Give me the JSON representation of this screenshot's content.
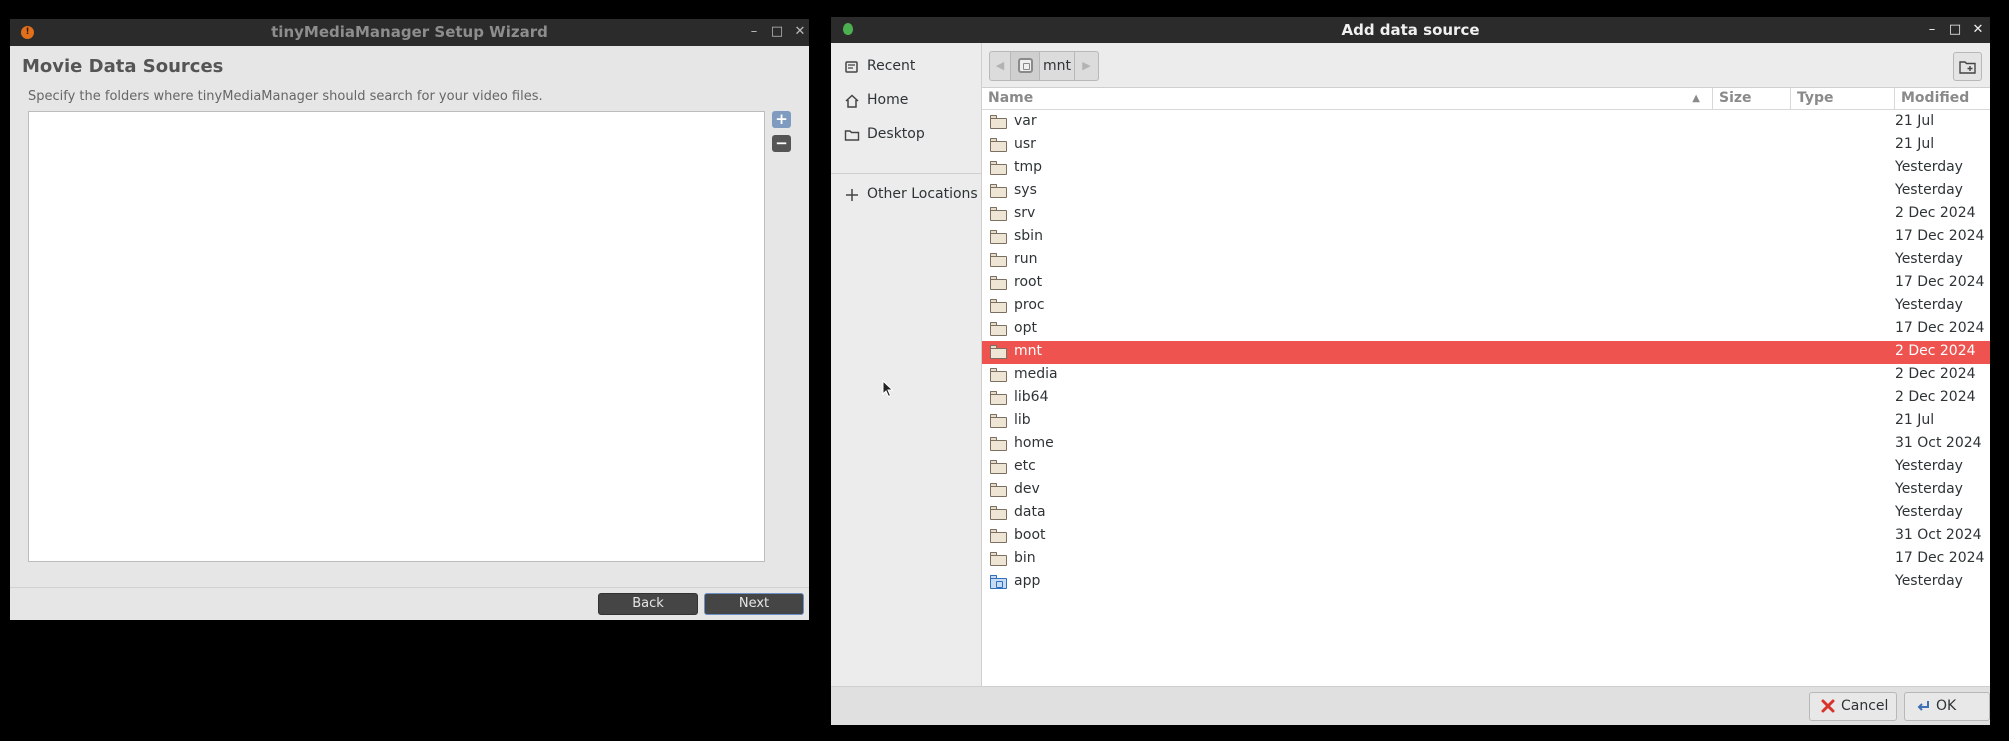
{
  "wizard": {
    "title": "tinyMediaManager Setup Wizard",
    "heading": "Movie Data Sources",
    "description": "Specify the folders where tinyMediaManager should search for your video files.",
    "add_label": "+",
    "remove_label": "−",
    "back_label": "Back",
    "next_label": "Next",
    "controls": {
      "minimize": "–",
      "maximize": "□",
      "close": "✕"
    }
  },
  "dialog": {
    "title": "Add data source",
    "controls": {
      "minimize": "–",
      "maximize": "□",
      "close": "✕"
    },
    "places": [
      {
        "label": "Recent",
        "icon": "recent-icon"
      },
      {
        "label": "Home",
        "icon": "home-icon"
      },
      {
        "label": "Desktop",
        "icon": "folder-icon"
      },
      {
        "label": "Other Locations",
        "icon": "plus-icon"
      }
    ],
    "pathbar": {
      "current": "mnt",
      "back": "◀",
      "forward": "▶"
    },
    "columns": {
      "name": "Name",
      "size": "Size",
      "type": "Type",
      "modified": "Modified"
    },
    "sort_indicator": "▲",
    "files": [
      {
        "name": "var",
        "modified": "21 Jul"
      },
      {
        "name": "usr",
        "modified": "21 Jul"
      },
      {
        "name": "tmp",
        "modified": "Yesterday"
      },
      {
        "name": "sys",
        "modified": "Yesterday"
      },
      {
        "name": "srv",
        "modified": "2 Dec 2024"
      },
      {
        "name": "sbin",
        "modified": "17 Dec 2024"
      },
      {
        "name": "run",
        "modified": "Yesterday"
      },
      {
        "name": "root",
        "modified": "17 Dec 2024"
      },
      {
        "name": "proc",
        "modified": "Yesterday"
      },
      {
        "name": "opt",
        "modified": "17 Dec 2024"
      },
      {
        "name": "mnt",
        "modified": "2 Dec 2024",
        "selected": true
      },
      {
        "name": "media",
        "modified": "2 Dec 2024"
      },
      {
        "name": "lib64",
        "modified": "2 Dec 2024"
      },
      {
        "name": "lib",
        "modified": "21 Jul"
      },
      {
        "name": "home",
        "modified": "31 Oct 2024"
      },
      {
        "name": "etc",
        "modified": "Yesterday"
      },
      {
        "name": "dev",
        "modified": "Yesterday"
      },
      {
        "name": "data",
        "modified": "Yesterday"
      },
      {
        "name": "boot",
        "modified": "31 Oct 2024"
      },
      {
        "name": "bin",
        "modified": "17 Dec 2024"
      },
      {
        "name": "app",
        "modified": "Yesterday",
        "special": true
      }
    ],
    "cancel_label": "Cancel",
    "ok_label": "OK"
  },
  "colors": {
    "selection": "#ef5350",
    "titlebar": "#2b2b2b",
    "wizard_button": "#454545",
    "wizard_add": "#7f9bbf",
    "wizard_remove": "#555555"
  }
}
